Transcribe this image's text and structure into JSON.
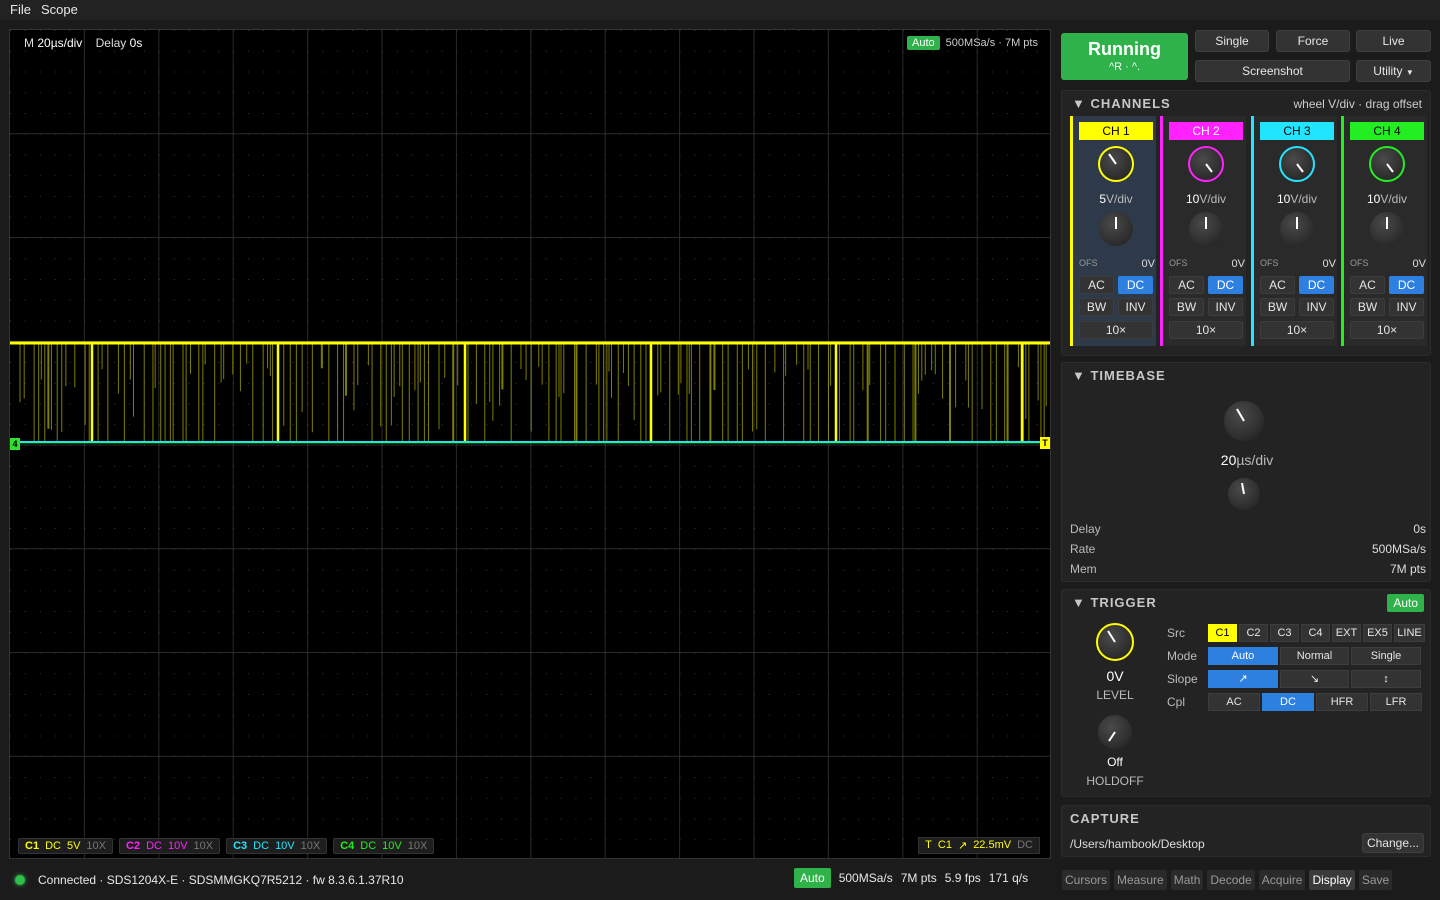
{
  "menu": [
    "File",
    "Scope"
  ],
  "scope": {
    "timebase_label": "M",
    "timebase": "20µs/div",
    "delay_label": "Delay",
    "delay": "0s",
    "mode": "Auto",
    "rate_info": "500MSa/s · 7M pts",
    "tags": [
      {
        "id": "C1",
        "cpl": "DC",
        "vdiv": "5V",
        "probe": "10X",
        "color": "#ffff00"
      },
      {
        "id": "C2",
        "cpl": "DC",
        "vdiv": "10V",
        "probe": "10X",
        "color": "#ff22ff"
      },
      {
        "id": "C3",
        "cpl": "DC",
        "vdiv": "10V",
        "probe": "10X",
        "color": "#22e6ff"
      },
      {
        "id": "C4",
        "cpl": "DC",
        "vdiv": "10V",
        "probe": "10X",
        "color": "#22ee22"
      }
    ],
    "trigger_tag": {
      "t": "T",
      "src": "C1",
      "slope": "↗",
      "level": "22.5mV",
      "cpl": "DC"
    },
    "ground_marker": "4",
    "trigger_marker": "T"
  },
  "status": {
    "connection": "Connected · SDS1204X-E · SDSMMGKQ7R5212 · fw 8.3.6.1.37R10",
    "mode": "Auto",
    "rate": "500MSa/s",
    "pts": "7M pts",
    "fps": "5.9 fps",
    "qs": "171 q/s"
  },
  "tabs": [
    "Cursors",
    "Measure",
    "Math",
    "Decode",
    "Acquire",
    "Display",
    "Save"
  ],
  "tab_active": "Display",
  "controls": {
    "run_label": "Running",
    "run_hint": "^R · ^.",
    "single": "Single",
    "force": "Force",
    "live": "Live",
    "screenshot": "Screenshot",
    "utility": "Utility"
  },
  "channels": {
    "title": "CHANNELS",
    "hint": "wheel V/div · drag offset",
    "items": [
      {
        "name": "CH 1",
        "vdiv_num": "5",
        "vdiv_unit": "V/div",
        "ofs_label": "OFS",
        "ofs": "0V",
        "ac": "AC",
        "dc": "DC",
        "bw": "BW",
        "inv": "INV",
        "probe": "10×",
        "color": "#ffff00",
        "text": "#000000"
      },
      {
        "name": "CH 2",
        "vdiv_num": "10",
        "vdiv_unit": "V/div",
        "ofs_label": "OFS",
        "ofs": "0V",
        "ac": "AC",
        "dc": "DC",
        "bw": "BW",
        "inv": "INV",
        "probe": "10×",
        "color": "#ff22ff",
        "text": "#ffffff"
      },
      {
        "name": "CH 3",
        "vdiv_num": "10",
        "vdiv_unit": "V/div",
        "ofs_label": "OFS",
        "ofs": "0V",
        "ac": "AC",
        "dc": "DC",
        "bw": "BW",
        "inv": "INV",
        "probe": "10×",
        "color": "#22e6ff",
        "text": "#000000"
      },
      {
        "name": "CH 4",
        "vdiv_num": "10",
        "vdiv_unit": "V/div",
        "ofs_label": "OFS",
        "ofs": "0V",
        "ac": "AC",
        "dc": "DC",
        "bw": "BW",
        "inv": "INV",
        "probe": "10×",
        "color": "#22ee22",
        "text": "#000000"
      }
    ]
  },
  "timebase": {
    "title": "TIMEBASE",
    "value_num": "20",
    "value_unit": "µs/div",
    "delay_label": "Delay",
    "delay": "0s",
    "rate_label": "Rate",
    "rate": "500MSa/s",
    "mem_label": "Mem",
    "mem": "7M pts"
  },
  "trigger": {
    "title": "TRIGGER",
    "badge": "Auto",
    "level": "0V",
    "level_label": "LEVEL",
    "holdoff": "Off",
    "holdoff_label": "HOLDOFF",
    "src_label": "Src",
    "sources": [
      "C1",
      "C2",
      "C3",
      "C4",
      "EXT",
      "EX5",
      "LINE"
    ],
    "mode_label": "Mode",
    "modes": [
      "Auto",
      "Normal",
      "Single"
    ],
    "slope_label": "Slope",
    "slopes": [
      "↗",
      "↘",
      "↕"
    ],
    "cpl_label": "Cpl",
    "couplings": [
      "AC",
      "DC",
      "HFR",
      "LFR"
    ]
  },
  "capture": {
    "title": "CAPTURE",
    "path": "/Users/hambook/Desktop",
    "change": "Change..."
  }
}
